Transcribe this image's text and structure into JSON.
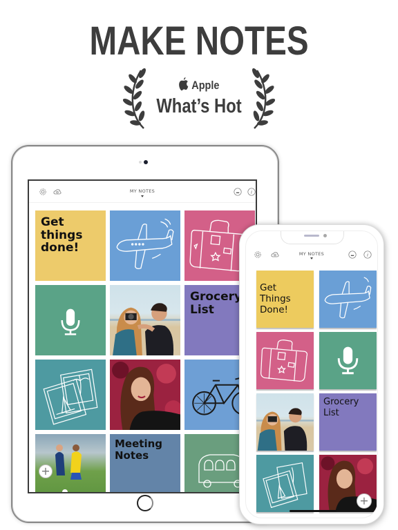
{
  "promo": {
    "headline": "MAKE NOTES",
    "award_brand": "Apple",
    "award_title": "What’s Hot",
    "icons": [
      "laurel-left",
      "apple-logo",
      "laurel-right"
    ]
  },
  "ipad": {
    "app_bar": {
      "title": "MY NOTES",
      "left_icons": [
        "gear-icon",
        "cloud-sync-icon"
      ],
      "right_icons": [
        "image-icon",
        "info-icon"
      ]
    },
    "tiles": [
      {
        "type": "text",
        "label_line1": "Get",
        "label_line2": "things",
        "label_line3": "done!",
        "color": "#EDCB6B"
      },
      {
        "type": "drawing",
        "icon": "airplane",
        "color": "#6A9FD6"
      },
      {
        "type": "drawing",
        "icon": "suitcase",
        "color": "#D36088"
      },
      {
        "type": "audio",
        "icon": "microphone",
        "color": "#5AA387"
      },
      {
        "type": "photo",
        "subject": "couple with camera on beach"
      },
      {
        "type": "text",
        "label_line1": "Grocery",
        "label_line2": "List",
        "color": "#8279BE"
      },
      {
        "type": "drawing",
        "icon": "photos",
        "color": "#4E9AA1"
      },
      {
        "type": "photo",
        "subject": "woman portrait with red leaves"
      },
      {
        "type": "drawing",
        "icon": "bicycle",
        "color": "#6E9FD5"
      },
      {
        "type": "photo",
        "subject": "women's soccer match"
      },
      {
        "type": "text",
        "label_line1": "Meeting",
        "label_line2": "Notes",
        "color": "#6384A8"
      },
      {
        "type": "drawing",
        "icon": "bus",
        "color": "#6A9E7E"
      }
    ],
    "fab_label": "+"
  },
  "iphone": {
    "app_bar": {
      "title": "MY NOTES",
      "left_icons": [
        "gear-icon",
        "cloud-sync-icon"
      ],
      "right_icons": [
        "image-icon",
        "info-icon"
      ]
    },
    "tiles": [
      {
        "type": "text",
        "label_line1": "Get",
        "label_line2": "Things",
        "label_line3": "Done!",
        "color": "#EDCB5E"
      },
      {
        "type": "drawing",
        "icon": "airplane",
        "color": "#6A9FD6"
      },
      {
        "type": "drawing",
        "icon": "suitcase",
        "color": "#D36088"
      },
      {
        "type": "audio",
        "icon": "microphone",
        "color": "#5AA387"
      },
      {
        "type": "photo",
        "subject": "couple with camera on beach"
      },
      {
        "type": "text",
        "label_line1": "Grocery",
        "label_line2": "List",
        "color": "#8279BE"
      },
      {
        "type": "drawing",
        "icon": "photos",
        "color": "#4E9AA1"
      },
      {
        "type": "photo",
        "subject": "woman portrait with red leaves"
      }
    ],
    "fab_label": "+"
  }
}
